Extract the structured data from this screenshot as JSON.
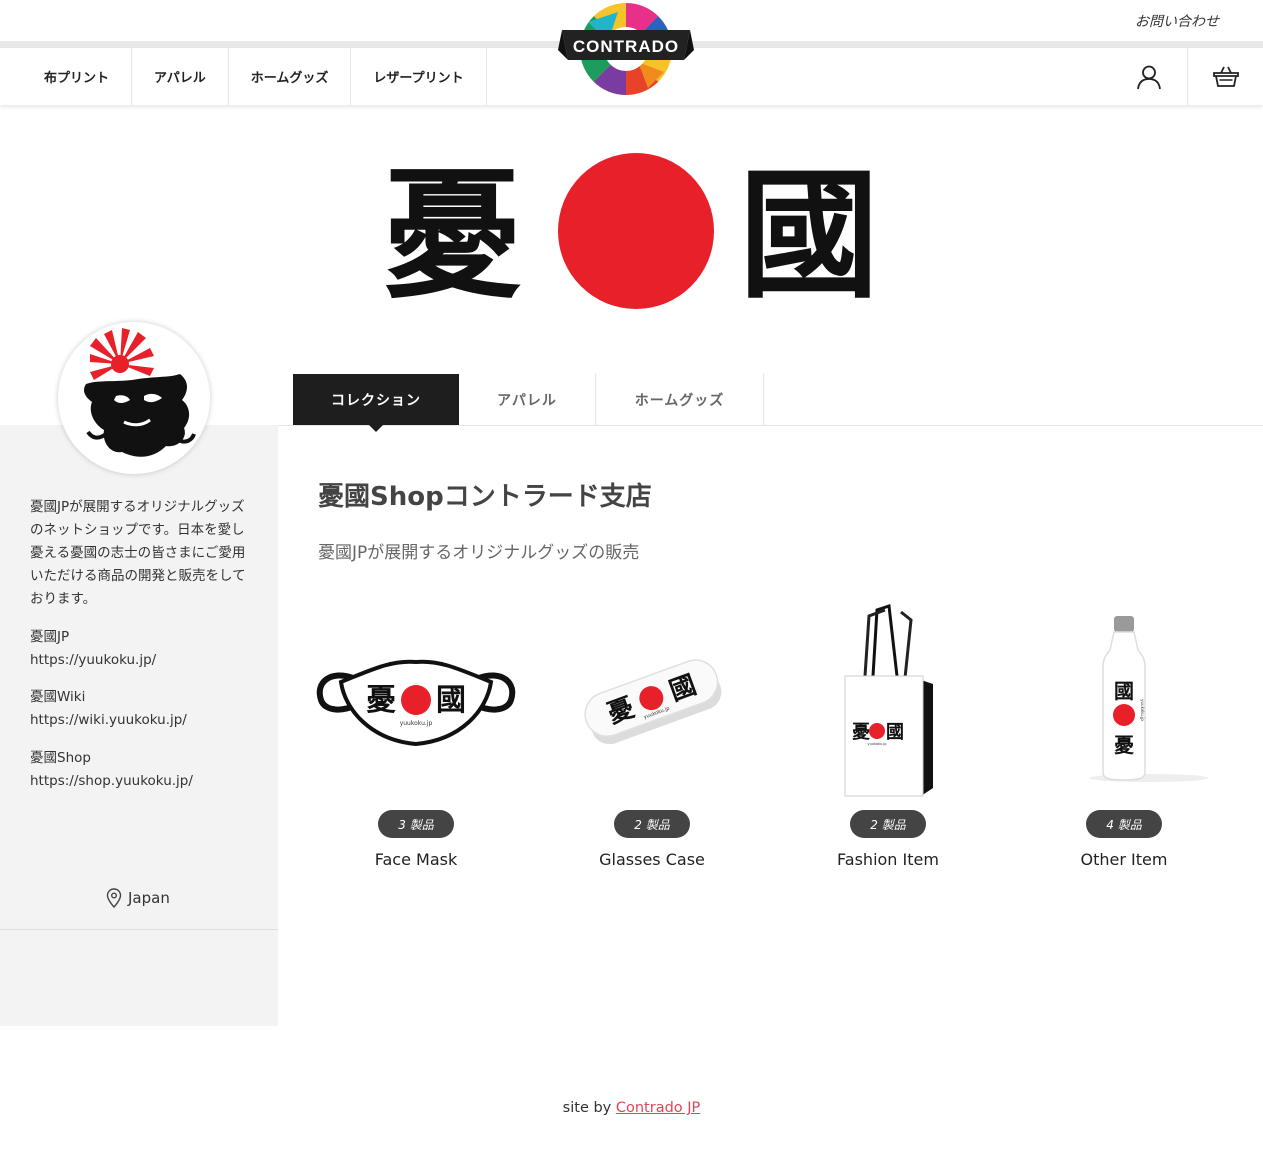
{
  "header": {
    "contact_label": "お問い合わせ",
    "nav_items": [
      "布プリント",
      "アパレル",
      "ホームグッズ",
      "レザープリント"
    ],
    "logo_text": "CONTRADO"
  },
  "banner": {
    "left_char": "憂",
    "right_char": "國"
  },
  "profile": {
    "bio": "憂國JPが展開するオリジナルグッズのネットショップです。日本を愛し憂える憂國の志士の皆さまにご愛用いただける商品の開発と販売をしております。",
    "links": [
      {
        "title": "憂國JP",
        "url": "https://yuukoku.jp/"
      },
      {
        "title": "憂國Wiki",
        "url": "https://wiki.yuukoku.jp/"
      },
      {
        "title": "憂國Shop",
        "url": "https://shop.yuukoku.jp/"
      }
    ],
    "location": "Japan"
  },
  "tabs": [
    "コレクション",
    "アパレル",
    "ホームグッズ"
  ],
  "shop": {
    "title": "憂國Shopコントラード支店",
    "description": "憂國JPが展開するオリジナルグッズの販売"
  },
  "products": [
    {
      "name": "Face Mask",
      "count": "3 製品",
      "print_text": "yuukoku.jp"
    },
    {
      "name": "Glasses Case",
      "count": "2 製品",
      "print_text": "yuukoku.jp"
    },
    {
      "name": "Fashion Item",
      "count": "2 製品",
      "print_text": "yuukoku.jp"
    },
    {
      "name": "Other Item",
      "count": "4 製品",
      "print_text": "yuukoku.jp"
    }
  ],
  "footer": {
    "prefix": "site by",
    "link_text": "Contrado JP"
  },
  "colors": {
    "accent_red": "#e8202a",
    "footer_link": "#e0445a",
    "tab_active": "#1e1e1e"
  }
}
